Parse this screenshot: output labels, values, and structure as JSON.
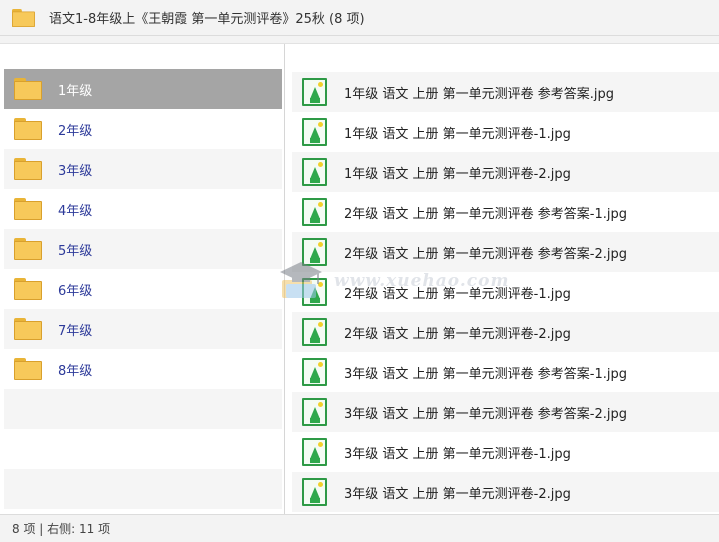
{
  "window": {
    "title": "语文1-8年级上《王朝霞 第一单元测评卷》25秋 (8 项)"
  },
  "left_pane": {
    "items": [
      {
        "label": "1年级",
        "icon": "folder-icon",
        "selected": true
      },
      {
        "label": "2年级",
        "icon": "folder-icon"
      },
      {
        "label": "3年级",
        "icon": "folder-icon"
      },
      {
        "label": "4年级",
        "icon": "folder-icon"
      },
      {
        "label": "5年级",
        "icon": "folder-icon"
      },
      {
        "label": "6年级",
        "icon": "folder-icon"
      },
      {
        "label": "7年级",
        "icon": "folder-icon"
      },
      {
        "label": "8年级",
        "icon": "folder-icon"
      }
    ]
  },
  "right_pane": {
    "files": [
      {
        "name": "1年级 语文 上册 第一单元测评卷 参考答案.jpg",
        "icon": "image-file-icon"
      },
      {
        "name": "1年级 语文 上册 第一单元测评卷-1.jpg",
        "icon": "image-file-icon"
      },
      {
        "name": "1年级 语文 上册 第一单元测评卷-2.jpg",
        "icon": "image-file-icon"
      },
      {
        "name": "2年级 语文 上册 第一单元测评卷 参考答案-1.jpg",
        "icon": "image-file-icon"
      },
      {
        "name": "2年级 语文 上册 第一单元测评卷 参考答案-2.jpg",
        "icon": "image-file-icon"
      },
      {
        "name": "2年级 语文 上册 第一单元测评卷-1.jpg",
        "icon": "image-file-icon"
      },
      {
        "name": "2年级 语文 上册 第一单元测评卷-2.jpg",
        "icon": "image-file-icon"
      },
      {
        "name": "3年级 语文 上册 第一单元测评卷 参考答案-1.jpg",
        "icon": "image-file-icon"
      },
      {
        "name": "3年级 语文 上册 第一单元测评卷 参考答案-2.jpg",
        "icon": "image-file-icon"
      },
      {
        "name": "3年级 语文 上册 第一单元测评卷-1.jpg",
        "icon": "image-file-icon"
      },
      {
        "name": "3年级 语文 上册 第一单元测评卷-2.jpg",
        "icon": "image-file-icon"
      }
    ]
  },
  "watermark": {
    "text": "www.xuehao.com"
  },
  "status_bar": {
    "text": "8 项 | 右侧: 11 项"
  },
  "colors": {
    "selected_row": "#a5a5a5",
    "folder_label": "#2d3a9a",
    "folder_fill": "#f7c95a",
    "image_icon": "#2fa84c"
  }
}
